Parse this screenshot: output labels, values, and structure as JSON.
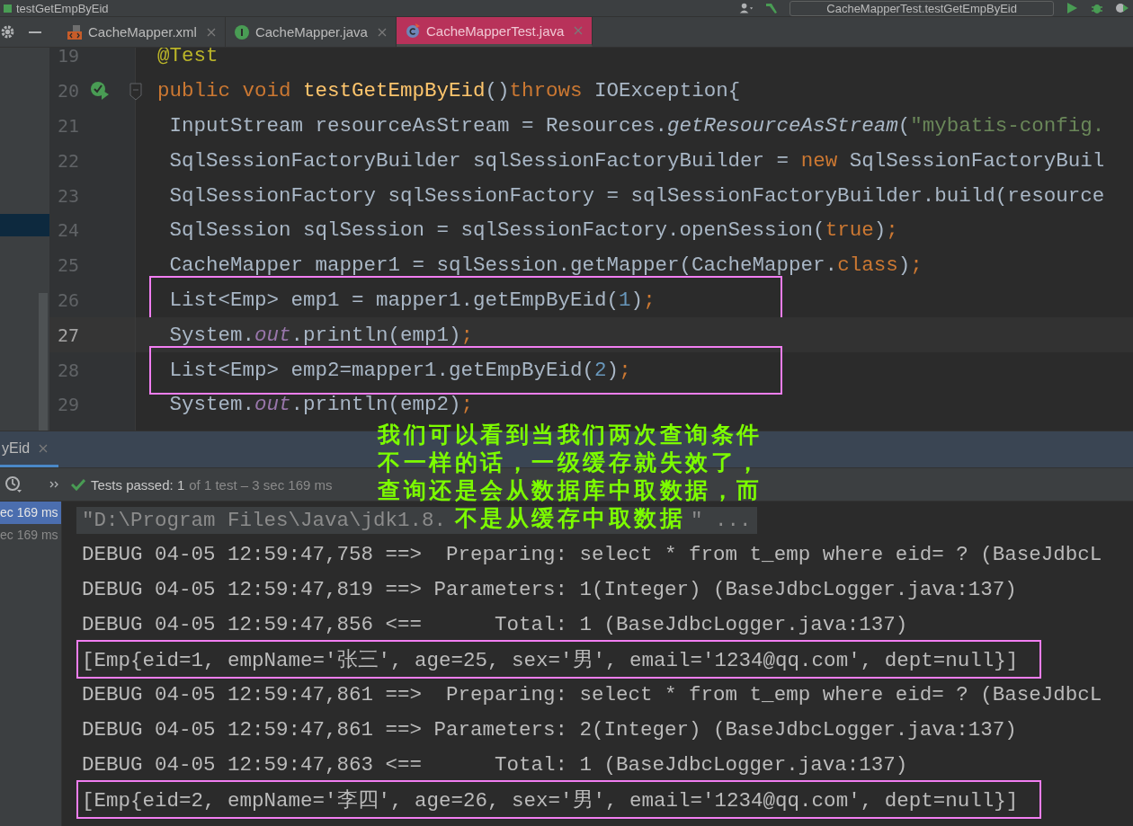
{
  "window": {
    "title": "testGetEmpByEid"
  },
  "toolbar": {
    "run_config": "CacheMapperTest.testGetEmpByEid"
  },
  "tabs": [
    {
      "label": "CacheMapper.xml",
      "kind": "xml",
      "selected": false
    },
    {
      "label": "CacheMapper.java",
      "kind": "interface",
      "selected": false
    },
    {
      "label": "CacheMapperTest.java",
      "kind": "test",
      "selected": true
    }
  ],
  "editor": {
    "lines": [
      {
        "number": "19",
        "kind": "annotation",
        "current": false,
        "boxed": false,
        "tokens": [
          {
            "text": "@Test",
            "kind": "annotation"
          }
        ]
      },
      {
        "number": "20",
        "kind": "method_start",
        "current": false,
        "boxed": false,
        "tokens": [
          {
            "text": "public void ",
            "kind": "keyword"
          },
          {
            "text": "testGetEmpByEid",
            "kind": "method"
          },
          {
            "text": "()",
            "kind": "plain"
          },
          {
            "text": "throws",
            "kind": "keyword"
          },
          {
            "text": " IOException{",
            "kind": "plain"
          }
        ]
      },
      {
        "number": "21",
        "kind": "statement",
        "current": false,
        "boxed": false,
        "tokens": [
          {
            "text": " InputStream resourceAsStream = Resources.",
            "kind": "plain"
          },
          {
            "text": "getResourceAsStream",
            "kind": "italic"
          },
          {
            "text": "(",
            "kind": "plain"
          },
          {
            "text": "\"mybatis-config.",
            "kind": "string"
          }
        ]
      },
      {
        "number": "22",
        "kind": "statement",
        "current": false,
        "boxed": false,
        "tokens": [
          {
            "text": " SqlSessionFactoryBuilder sqlSessionFactoryBuilder = ",
            "kind": "plain"
          },
          {
            "text": "new",
            "kind": "keyword"
          },
          {
            "text": " SqlSessionFactoryBuil",
            "kind": "plain"
          }
        ]
      },
      {
        "number": "23",
        "kind": "statement",
        "current": false,
        "boxed": false,
        "tokens": [
          {
            "text": " SqlSessionFactory sqlSessionFactory = sqlSessionFactoryBuilder.build(resource",
            "kind": "plain"
          }
        ]
      },
      {
        "number": "24",
        "kind": "statement",
        "current": false,
        "boxed": false,
        "tokens": [
          {
            "text": " SqlSession sqlSession = sqlSessionFactory.openSession(",
            "kind": "plain"
          },
          {
            "text": "true",
            "kind": "keyword"
          },
          {
            "text": ")",
            "kind": "plain"
          },
          {
            "text": ";",
            "kind": "keyword"
          }
        ]
      },
      {
        "number": "25",
        "kind": "statement",
        "current": false,
        "boxed": false,
        "tokens": [
          {
            "text": " CacheMapper mapper1 = sqlSession.getMapper(CacheMapper.",
            "kind": "plain"
          },
          {
            "text": "class",
            "kind": "keyword"
          },
          {
            "text": ")",
            "kind": "plain"
          },
          {
            "text": ";",
            "kind": "keyword"
          }
        ]
      },
      {
        "number": "26",
        "kind": "statement",
        "current": false,
        "boxed": true,
        "tokens": [
          {
            "text": " List<Emp> emp1 = mapper1.getEmpByEid(",
            "kind": "plain"
          },
          {
            "text": "1",
            "kind": "number"
          },
          {
            "text": ")",
            "kind": "plain"
          },
          {
            "text": ";",
            "kind": "keyword"
          }
        ]
      },
      {
        "number": "27",
        "kind": "statement",
        "current": true,
        "boxed": false,
        "tokens": [
          {
            "text": " System.",
            "kind": "plain"
          },
          {
            "text": "out",
            "kind": "field"
          },
          {
            "text": ".println(emp1)",
            "kind": "plain"
          },
          {
            "text": ";",
            "kind": "keyword"
          }
        ]
      },
      {
        "number": "28",
        "kind": "statement",
        "current": false,
        "boxed": true,
        "tokens": [
          {
            "text": " List<Emp> emp2=mapper1.getEmpByEid(",
            "kind": "plain"
          },
          {
            "text": "2",
            "kind": "number"
          },
          {
            "text": ")",
            "kind": "plain"
          },
          {
            "text": ";",
            "kind": "keyword"
          }
        ]
      },
      {
        "number": "29",
        "kind": "statement",
        "current": false,
        "boxed": false,
        "tokens": [
          {
            "text": " System.",
            "kind": "plain"
          },
          {
            "text": "out",
            "kind": "field"
          },
          {
            "text": ".println(emp2)",
            "kind": "plain"
          },
          {
            "text": ";",
            "kind": "keyword"
          }
        ]
      }
    ]
  },
  "run_panel": {
    "tab": "yEid",
    "status": "Tests passed: 1",
    "status_detail": "of 1 test – 3 sec 169 ms",
    "tree": [
      {
        "label": "ec 169 ms",
        "selected": true
      },
      {
        "label": "ec 169 ms",
        "selected": false
      }
    ],
    "console": [
      {
        "kind": "command",
        "text": "\"D:\\Program Files\\Java\\jdk1.8.",
        "text_after": "\" ..."
      },
      {
        "kind": "log",
        "text": "DEBUG 04-05 12:59:47,758 ==>  Preparing: select * from t_emp where eid= ? (BaseJdbcL",
        "boxed": false
      },
      {
        "kind": "log",
        "text": "DEBUG 04-05 12:59:47,819 ==> Parameters: 1(Integer) (BaseJdbcLogger.java:137)",
        "boxed": false
      },
      {
        "kind": "log",
        "text": "DEBUG 04-05 12:59:47,856 <==      Total: 1 (BaseJdbcLogger.java:137)",
        "boxed": false
      },
      {
        "kind": "log",
        "text": "[Emp{eid=1, empName='张三', age=25, sex='男', email='1234@qq.com', dept=null}]",
        "boxed": true
      },
      {
        "kind": "log",
        "text": "DEBUG 04-05 12:59:47,861 ==>  Preparing: select * from t_emp where eid= ? (BaseJdbcL",
        "boxed": false
      },
      {
        "kind": "log",
        "text": "DEBUG 04-05 12:59:47,861 ==> Parameters: 2(Integer) (BaseJdbcLogger.java:137)",
        "boxed": false
      },
      {
        "kind": "log",
        "text": "DEBUG 04-05 12:59:47,863 <==      Total: 1 (BaseJdbcLogger.java:137)",
        "boxed": false
      },
      {
        "kind": "log",
        "text": "[Emp{eid=2, empName='李四', age=26, sex='男', email='1234@qq.com', dept=null}]",
        "boxed": true
      }
    ]
  },
  "annotation": {
    "lines": [
      "我们可以看到当我们两次查询条件",
      "不一样的话，一级缓存就失效了，",
      "查询还是会从数据库中取数据，而",
      "不是从缓存中取数据"
    ]
  }
}
